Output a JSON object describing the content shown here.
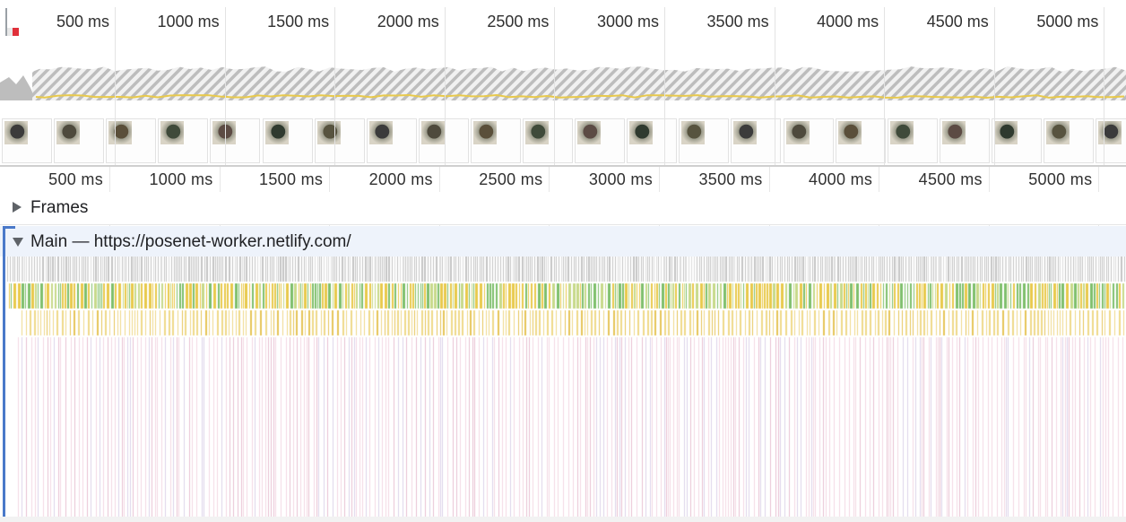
{
  "overview": {
    "ticks": [
      "500 ms",
      "1000 ms",
      "1500 ms",
      "2000 ms",
      "2500 ms",
      "3000 ms",
      "3500 ms",
      "4000 ms",
      "4500 ms",
      "5000 ms"
    ],
    "screenshot_count": 22
  },
  "ruler": {
    "ticks": [
      "500 ms",
      "1000 ms",
      "1500 ms",
      "2000 ms",
      "2500 ms",
      "3000 ms",
      "3500 ms",
      "4000 ms",
      "4500 ms",
      "5000 ms"
    ]
  },
  "tracks": {
    "frames_label": "Frames",
    "main_label": "Main — https://posenet-worker.netlify.com/"
  },
  "colors": {
    "scripting": "#e8c94b",
    "rendering": "#9a7fd1",
    "painting": "#7ebf6b",
    "system": "#c9c9c9",
    "idle_pink": "#f0c7d7",
    "selection_blue": "#4a79c9",
    "long_task_red": "#e0303a"
  },
  "icons": [
    "expand-triangle-icon",
    "collapse-triangle-icon"
  ]
}
